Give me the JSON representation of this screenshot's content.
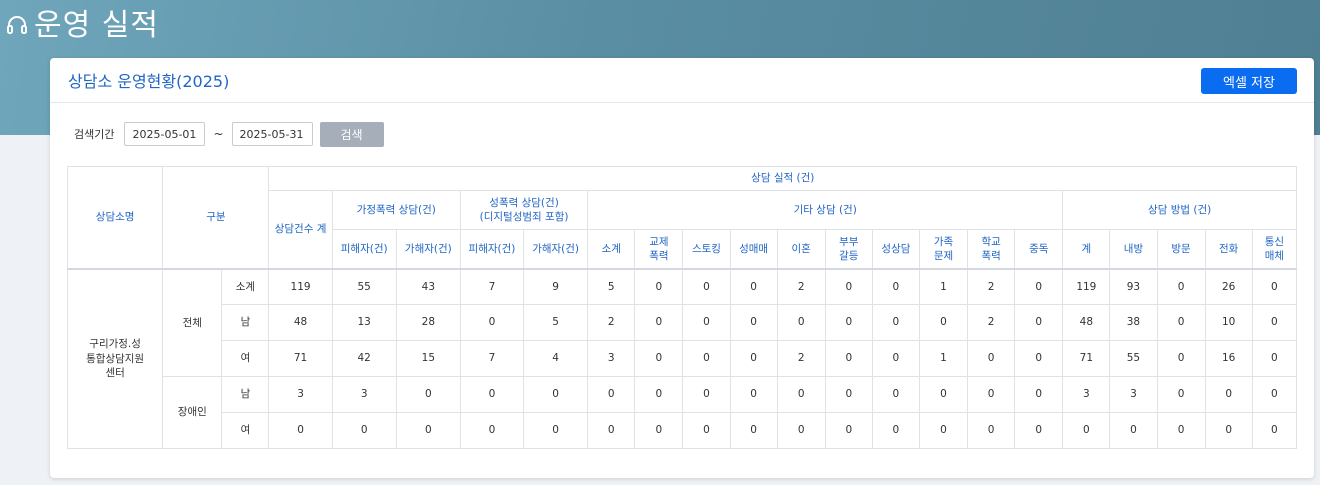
{
  "page": {
    "title": "운영 실적",
    "title_icon": "headset-icon"
  },
  "card": {
    "title": "상담소 운영현황(2025)",
    "excel_label": "엑셀 저장"
  },
  "search": {
    "label": "검색기간",
    "start_date": "2025-05-01",
    "tilde": "~",
    "end_date": "2025-05-31",
    "button_label": "검색"
  },
  "table": {
    "headers": {
      "center_name": "상담소명",
      "category": "구분",
      "performance": "상담 실적 (건)",
      "total_count": "상담건수 계",
      "domestic": "가정폭력 상담(건)",
      "sexual": "성폭력 상담(건)\n(디지털성범죄 포함)",
      "other": "기타 상담 (건)",
      "method": "상담 방법 (건)",
      "domestic_victim": "피해자(건)",
      "domestic_perp": "가해자(건)",
      "sexual_victim": "피해자(건)",
      "sexual_perp": "가해자(건)",
      "other_cols": [
        "소계",
        "교제\n폭력",
        "스토킹",
        "성매매",
        "이혼",
        "부부\n갈등",
        "성상담",
        "가족\n문제",
        "학교\n폭력",
        "중독"
      ],
      "method_cols": [
        "계",
        "내방",
        "방문",
        "전화",
        "통신\n매체"
      ]
    },
    "center": "구리가정.성\n통합상담지원\n센터",
    "groups": [
      {
        "name": "전체",
        "rows": [
          {
            "label": "소계",
            "values": [
              "119",
              "55",
              "43",
              "7",
              "9",
              "5",
              "0",
              "0",
              "0",
              "2",
              "0",
              "0",
              "1",
              "2",
              "0",
              "119",
              "93",
              "0",
              "26",
              "0"
            ]
          },
          {
            "label": "남",
            "values": [
              "48",
              "13",
              "28",
              "0",
              "5",
              "2",
              "0",
              "0",
              "0",
              "0",
              "0",
              "0",
              "0",
              "2",
              "0",
              "48",
              "38",
              "0",
              "10",
              "0"
            ]
          },
          {
            "label": "여",
            "values": [
              "71",
              "42",
              "15",
              "7",
              "4",
              "3",
              "0",
              "0",
              "0",
              "2",
              "0",
              "0",
              "1",
              "0",
              "0",
              "71",
              "55",
              "0",
              "16",
              "0"
            ]
          }
        ]
      },
      {
        "name": "장애인",
        "rows": [
          {
            "label": "남",
            "values": [
              "3",
              "3",
              "0",
              "0",
              "0",
              "0",
              "0",
              "0",
              "0",
              "0",
              "0",
              "0",
              "0",
              "0",
              "0",
              "3",
              "3",
              "0",
              "0",
              "0"
            ]
          },
          {
            "label": "여",
            "values": [
              "0",
              "0",
              "0",
              "0",
              "0",
              "0",
              "0",
              "0",
              "0",
              "0",
              "0",
              "0",
              "0",
              "0",
              "0",
              "0",
              "0",
              "0",
              "0",
              "0"
            ]
          }
        ]
      }
    ]
  }
}
